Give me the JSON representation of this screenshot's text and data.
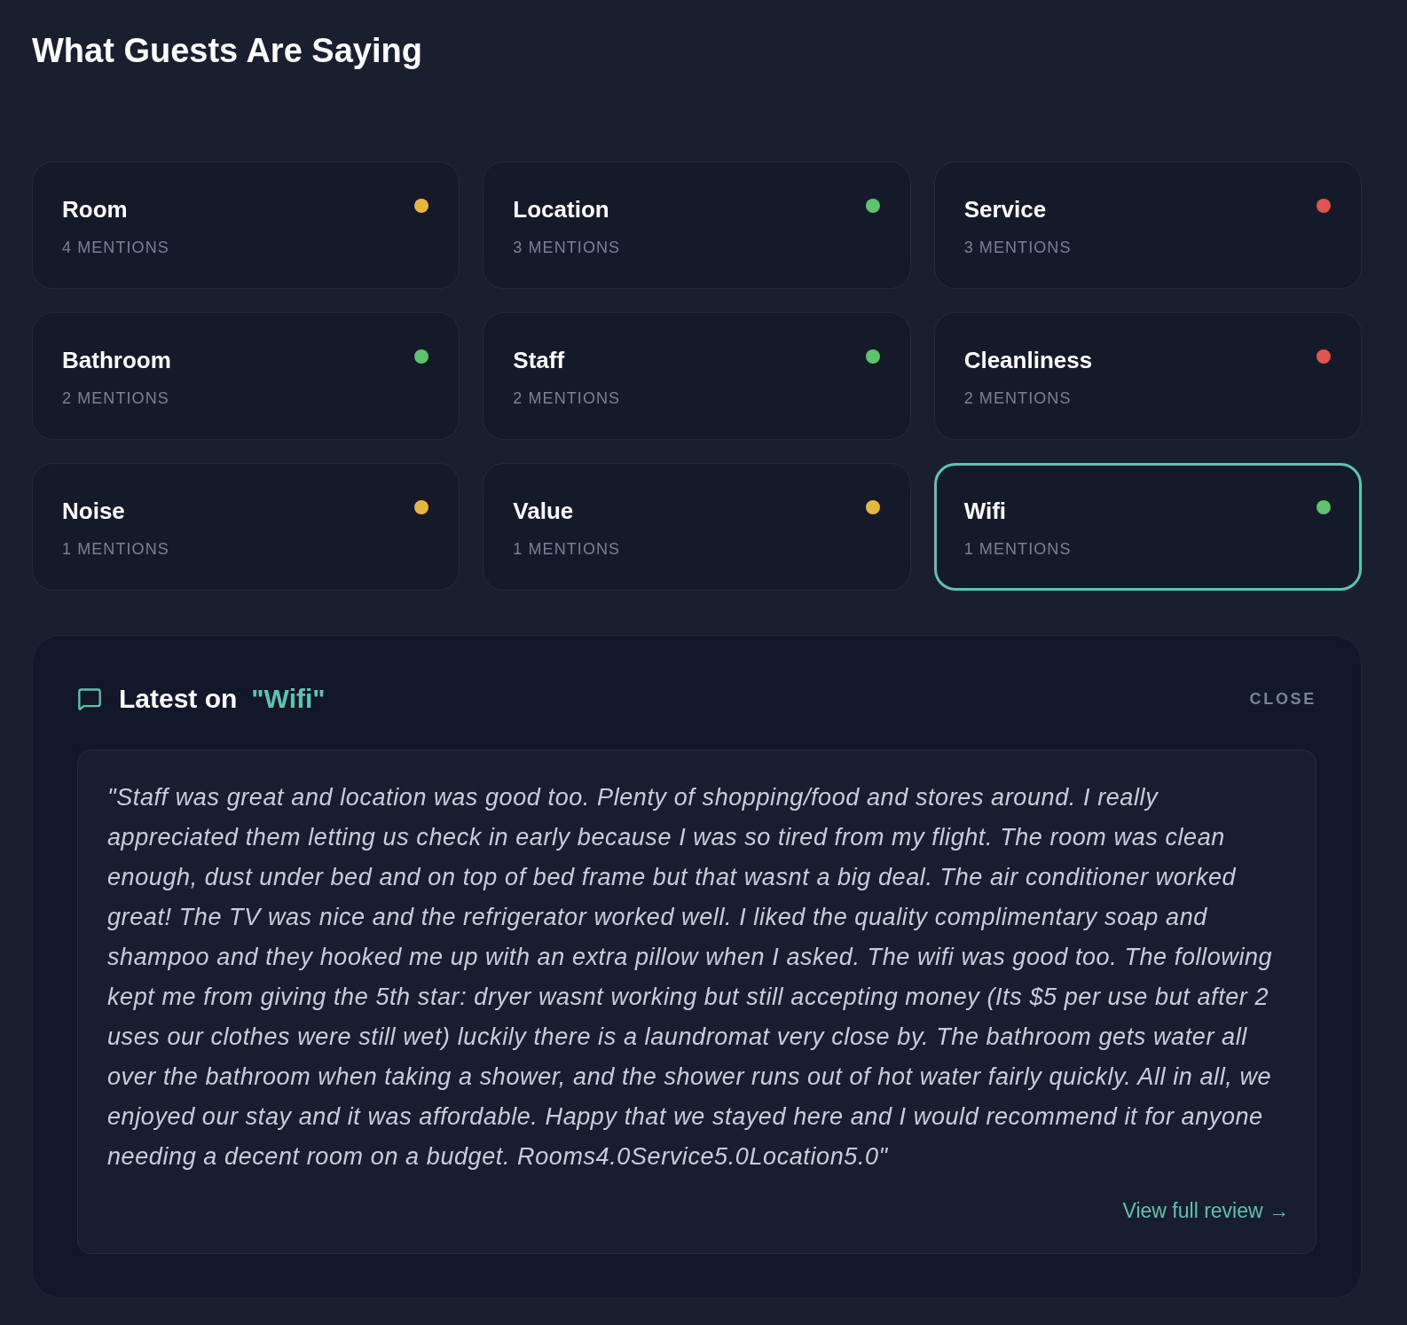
{
  "title": "What Guests Are Saying",
  "topics": [
    {
      "name": "Room",
      "mentions": "4 MENTIONS",
      "color": "#e6b63f",
      "selected": false
    },
    {
      "name": "Location",
      "mentions": "3 MENTIONS",
      "color": "#5cc46a",
      "selected": false
    },
    {
      "name": "Service",
      "mentions": "3 MENTIONS",
      "color": "#e05552",
      "selected": false
    },
    {
      "name": "Bathroom",
      "mentions": "2 MENTIONS",
      "color": "#5cc46a",
      "selected": false
    },
    {
      "name": "Staff",
      "mentions": "2 MENTIONS",
      "color": "#5cc46a",
      "selected": false
    },
    {
      "name": "Cleanliness",
      "mentions": "2 MENTIONS",
      "color": "#e05552",
      "selected": false
    },
    {
      "name": "Noise",
      "mentions": "1 MENTIONS",
      "color": "#e6b63f",
      "selected": false
    },
    {
      "name": "Value",
      "mentions": "1 MENTIONS",
      "color": "#e6b63f",
      "selected": false
    },
    {
      "name": "Wifi",
      "mentions": "1 MENTIONS",
      "color": "#5cc46a",
      "selected": true
    }
  ],
  "review_panel": {
    "heading": "Latest on",
    "topic": "\"Wifi\"",
    "close": "CLOSE",
    "quote": "\"Staff was great and location was good too. Plenty of shopping/food and stores around. I really appreciated them letting us check in early because I was so tired from my flight. The room was clean enough, dust under bed and on top of bed frame but that wasnt a big deal. The air conditioner worked great! The TV was nice and the refrigerator worked well. I liked the quality complimentary soap and shampoo and they hooked me up with an extra pillow when I asked. The wifi was good too. The following kept me from giving the 5th star: dryer wasnt working but still accepting money (Its $5 per use but after 2 uses our clothes were still wet) luckily there is a laundromat very close by. The bathroom gets water all over the bathroom when taking a shower, and the shower runs out of hot water fairly quickly. All in all, we enjoyed our stay and it was affordable. Happy that we stayed here and I would recommend it for anyone needing a decent room on a budget. Rooms4.0Service5.0Location5.0\"",
    "link": "View full review →"
  }
}
